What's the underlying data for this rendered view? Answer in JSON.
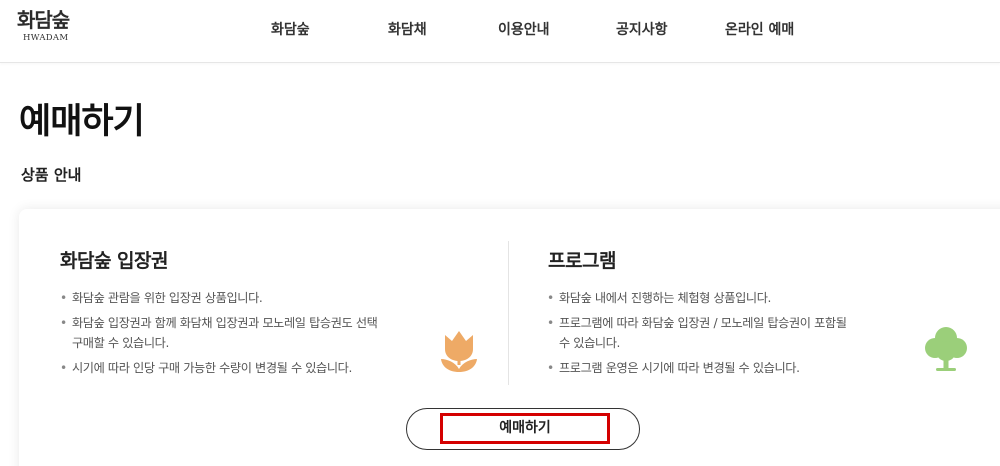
{
  "header": {
    "logo_text": "화담숲",
    "logo_sub": "HWADAM",
    "nav": [
      {
        "label": "화담숲"
      },
      {
        "label": "화담채"
      },
      {
        "label": "이용안내"
      },
      {
        "label": "공지사항"
      },
      {
        "label": "온라인 예매"
      }
    ]
  },
  "page": {
    "title": "예매하기",
    "section_title": "상품 안내"
  },
  "products": [
    {
      "title": "화담숲 입장권",
      "icon": "tulip-icon",
      "bullets": [
        "화담숲 관람을 위한 입장권 상품입니다.",
        "화담숲 입장권과 함께 화담채 입장권과 모노레일 탑승권도 선택",
        "구매할 수 있습니다.",
        "시기에 따라 인당 구매 가능한 수량이 변경될 수 있습니다."
      ]
    },
    {
      "title": "프로그램",
      "icon": "tree-icon",
      "bullets": [
        "화담숲 내에서 진행하는 체험형 상품입니다.",
        "프로그램에 따라 화담숲 입장권 / 모노레일 탑승권이 포함될",
        "수 있습니다.",
        "프로그램 운영은 시기에 따라 변경될 수 있습니다."
      ]
    }
  ],
  "reserve_button": {
    "label": "예매하기"
  },
  "colors": {
    "tulip": "#eeaa66",
    "tree": "#9bcf7a",
    "highlight_border": "#d40000"
  }
}
